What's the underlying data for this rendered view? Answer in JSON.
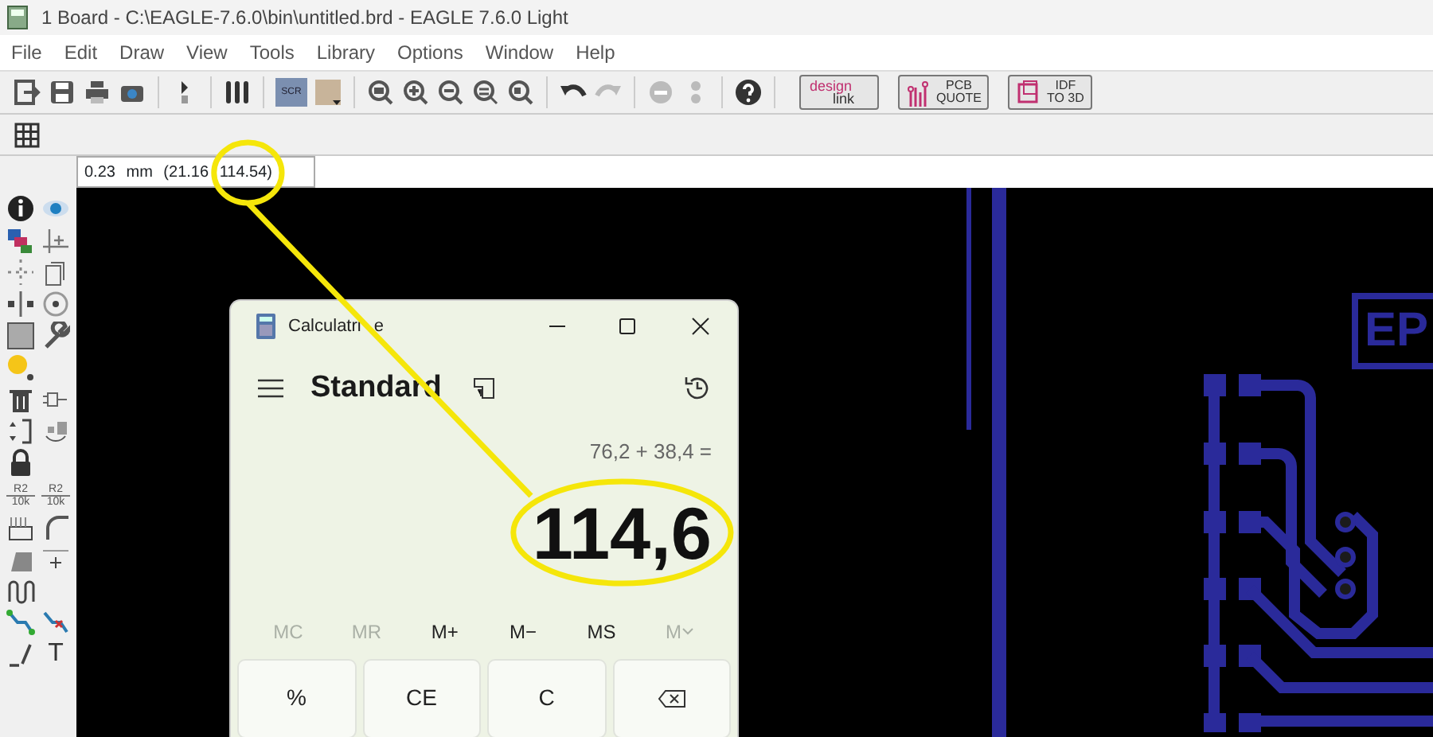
{
  "window": {
    "title": "1 Board - C:\\EAGLE-7.6.0\\bin\\untitled.brd - EAGLE 7.6.0 Light"
  },
  "menu": [
    "File",
    "Edit",
    "Draw",
    "View",
    "Tools",
    "Library",
    "Options",
    "Window",
    "Help"
  ],
  "toolbar": {
    "script_label": "SCR",
    "service_buttons": [
      {
        "kind": "design",
        "line1": "design",
        "line2": "link"
      },
      {
        "kind": "pcb",
        "line1": "PCB",
        "line2": "QUOTE"
      },
      {
        "kind": "idf",
        "line1": "IDF",
        "line2": "TO 3D"
      }
    ]
  },
  "coordinate_field": {
    "value": "0.23 mm (21.16 114.54)"
  },
  "left_toolbar": {
    "value_labels": [
      {
        "name": "R2",
        "value": "10k"
      },
      {
        "name": "R2",
        "value": "10k"
      }
    ],
    "text_tool": "T"
  },
  "board": {
    "label": "EP"
  },
  "calculator": {
    "title": "Calculatri",
    "title_rest": "e",
    "mode": "Standard",
    "expression": "76,2 + 38,4 =",
    "result": "114,6",
    "memory": [
      {
        "label": "MC",
        "disabled": true
      },
      {
        "label": "MR",
        "disabled": true
      },
      {
        "label": "M+",
        "disabled": false
      },
      {
        "label": "M−",
        "disabled": false
      },
      {
        "label": "MS",
        "disabled": false
      },
      {
        "label": "M",
        "disabled": true,
        "kind": "dropdown"
      }
    ],
    "keys": [
      {
        "kind": "text",
        "label": "%"
      },
      {
        "kind": "text",
        "label": "CE"
      },
      {
        "kind": "text",
        "label": "C"
      },
      {
        "kind": "backspace"
      }
    ]
  }
}
